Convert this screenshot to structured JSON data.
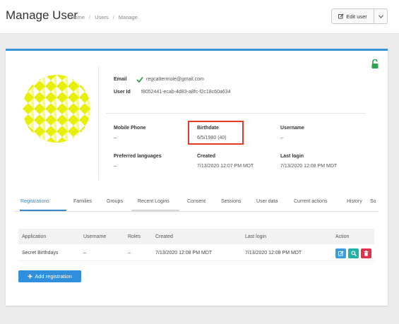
{
  "header": {
    "title": "Manage User",
    "breadcrumb": [
      "Home",
      "Users",
      "Manage"
    ],
    "edit_button_label": "Edit user"
  },
  "profile": {
    "email_label": "Email",
    "email": "regcattermole@gmail.com",
    "user_id_label": "User Id",
    "user_id": "f8052441-ecab-4d83-a8fc-f2c18c60a634",
    "mobile_phone_label": "Mobile Phone",
    "mobile_phone": "–",
    "birthdate_label": "Birthdate",
    "birthdate": "6/5/1980 (40)",
    "username_label": "Username",
    "username": "–",
    "preferred_languages_label": "Preferred languages",
    "preferred_languages": "–",
    "created_label": "Created",
    "created": "7/13/2020 12:07 PM MDT",
    "last_login_label": "Last login",
    "last_login": "7/13/2020 12:08 PM MDT"
  },
  "tabs": [
    "Registrations",
    "Families",
    "Groups",
    "Recent Logins",
    "Consent",
    "Sessions",
    "User data",
    "Current actions",
    "History",
    "So"
  ],
  "registrations": {
    "columns": [
      "Application",
      "Username",
      "Roles",
      "Created",
      "Last login",
      "Action"
    ],
    "rows": [
      {
        "application": "Secret Birthdays",
        "username": "–",
        "roles": "–",
        "created": "7/13/2020 12:08 PM MDT",
        "last_login": "7/13/2020 12:08 PM MDT"
      }
    ],
    "add_button_label": "Add registration"
  },
  "colors": {
    "accent": "#3a95d6",
    "highlight_box": "#e23a2a",
    "avatar_yellow": "#e6f000",
    "check_green": "#2ea44f",
    "action_blue": "#3a9ddc",
    "action_teal": "#20b2a6",
    "action_red": "#e0334a"
  },
  "icons": [
    "edit-icon",
    "chevron-down-icon",
    "unlock-icon",
    "check-icon",
    "plus-icon",
    "search-icon",
    "trash-icon"
  ]
}
